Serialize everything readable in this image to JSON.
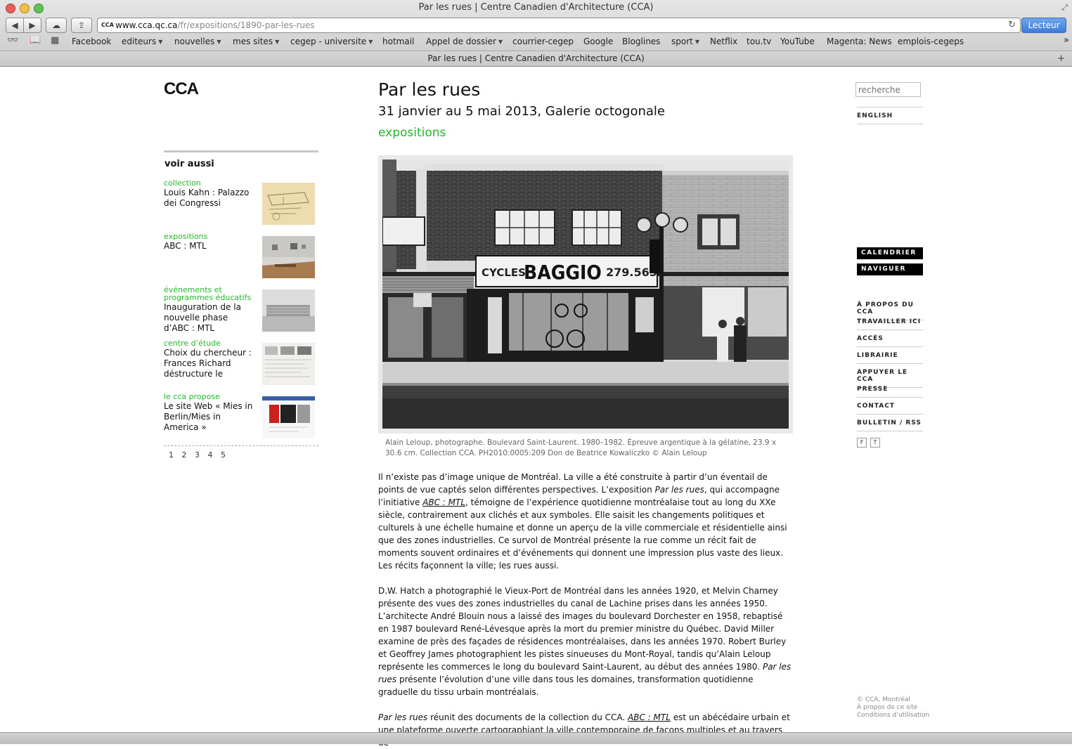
{
  "window": {
    "title": "Par les rues | Centre Canadien d'Architecture (CCA)"
  },
  "toolbar": {
    "url_host": "www.cca.qc.ca",
    "url_path": "/fr/expositions/1890-par-les-rues",
    "reader_label": "Lecteur",
    "favicon_text": "CCA"
  },
  "bookmarks": [
    {
      "label": "Facebook"
    },
    {
      "label": "editeurs",
      "menu": true
    },
    {
      "label": "nouvelles",
      "menu": true
    },
    {
      "label": "mes sites",
      "menu": true
    },
    {
      "label": "cegep - universite",
      "menu": true
    },
    {
      "label": "hotmail"
    },
    {
      "label": "Appel de dossier",
      "menu": true
    },
    {
      "label": "courrier-cegep"
    },
    {
      "label": "Google"
    },
    {
      "label": "Bloglines"
    },
    {
      "label": "sport",
      "menu": true
    },
    {
      "label": "Netflix"
    },
    {
      "label": "tou.tv"
    },
    {
      "label": "YouTube"
    },
    {
      "label": "Magenta: News"
    },
    {
      "label": "emplois-cegeps"
    }
  ],
  "tab": {
    "label": "Par les rues | Centre Canadien d'Architecture (CCA)"
  },
  "site": {
    "logo": "CCA"
  },
  "sidebar": {
    "heading": "voir aussi",
    "items": [
      {
        "category": "collection",
        "title": "Louis Kahn : Palazzo dei Congressi"
      },
      {
        "category": "expositions",
        "title": "ABC : MTL"
      },
      {
        "category": "événements et programmes éducatifs",
        "title": "Inauguration de la nouvelle phase d’ABC : MTL"
      },
      {
        "category": "centre d’étude",
        "title": "Choix du chercheur : Frances Richard déstructure le"
      },
      {
        "category": "le cca propose",
        "title": "Le site Web « Mies in Berlin/Mies in America »"
      }
    ],
    "pages": [
      "1",
      "2",
      "3",
      "4",
      "5"
    ]
  },
  "main": {
    "title": "Par les rues",
    "subtitle": "31 janvier au 5 mai 2013, Galerie octogonale",
    "category": "expositions",
    "photo": {
      "sign_left": "CYCLES",
      "sign_main": "BAGGIO",
      "sign_number": "279.565"
    },
    "caption": "Alain Leloup, photographe. Boulevard Saint-Laurent. 1980–1982. Épreuve argentique à la gélatine, 23.9 x 30.6 cm. Collection CCA. PH2010:0005:209 Don de Beatrice Kowaliczko © Alain Leloup",
    "p1": {
      "a": "Il n’existe pas d’image unique de Montréal. La ville a été construite à partir d’un éventail de points de vue captés selon différentes perspectives. L’exposition ",
      "b": "Par les rues",
      "c": ", qui accompagne l’initiative ",
      "link": "ABC : MTL",
      "d": ", témoigne de l’expérience quotidienne montréalaise tout au long du XXe siècle, contrairement aux clichés et aux symboles. Elle saisit les changements politiques et culturels à une échelle humaine et donne un aperçu de la ville commerciale et résidentielle ainsi que des zones industrielles. Ce survol de Montréal présente la rue comme un récit fait de moments souvent ordinaires et d’événements qui donnent une impression plus vaste des lieux. Les récits façonnent la ville; les rues aussi."
    },
    "p2": {
      "a": "D.W. Hatch a photographié le Vieux-Port de Montréal dans les années 1920, et Melvin Charney présente des vues des zones industrielles du canal de Lachine prises dans les années 1950. L’architecte André Blouin nous a laissé des images du boulevard Dorchester en 1958, rebaptisé en 1987 boulevard René-Lévesque après la mort du premier ministre du Québec. David Miller examine de près des façades de résidences montréalaises, dans les années 1970. Robert Burley et Geoffrey James photographient les pistes sinueuses du Mont-Royal, tandis qu’Alain Leloup représente les commerces le long du boulevard Saint-Laurent, au début des années 1980. ",
      "b": "Par les rues",
      "c": " présente l’évolution d’une ville dans tous les domaines, transformation quotidienne graduelle du tissu urbain montréalais."
    },
    "p3": {
      "a": "Par les rues",
      "b": " réunit des documents de la collection du CCA. ",
      "link": "ABC : MTL",
      "c": " est un abécédaire urbain et une plateforme ouverte cartographiant la ville contemporaine de façons multiples et au travers de"
    }
  },
  "right": {
    "search_placeholder": "recherche",
    "english": "ENGLISH",
    "calendrier": "CALENDRIER",
    "naviguer": "NAVIGUER",
    "menu": [
      "À PROPOS DU CCA",
      "TRAVAILLER ICI",
      "ACCÈS",
      "LIBRAIRIE",
      "APPUYER LE CCA",
      "PRESSE",
      "CONTACT",
      "BULLETIN / RSS"
    ],
    "social": [
      "F",
      "T"
    ],
    "footer": [
      "© CCA, Montréal",
      "À propos de ce site",
      "Conditions d’utilisation"
    ]
  },
  "colors": {
    "accent_green": "#24b82d",
    "reader_blue": "#4a86de"
  }
}
